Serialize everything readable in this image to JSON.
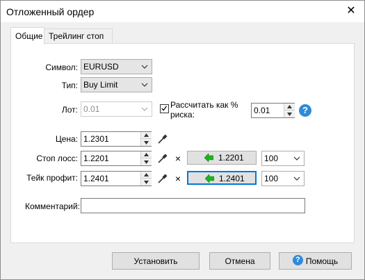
{
  "window": {
    "title": "Отложенный ордер",
    "close_glyph": "✕"
  },
  "tabs": [
    {
      "label": "Общие"
    },
    {
      "label": "Трейлинг стоп"
    }
  ],
  "form": {
    "symbol": {
      "label": "Символ:",
      "value": "EURUSD"
    },
    "type": {
      "label": "Тип:",
      "value": "Buy Limit"
    },
    "lot": {
      "label": "Лот:",
      "value": "0.01"
    },
    "risk": {
      "label_line1": "Рассчитать как %",
      "label_line2": "риска:",
      "checked": true,
      "value": "0.01"
    },
    "price": {
      "label": "Цена:",
      "value": "1.2301"
    },
    "stop_loss": {
      "label": "Стоп лосс:",
      "value": "1.2201",
      "button_value": "1.2201",
      "combo_value": "100"
    },
    "take_profit": {
      "label": "Тейк профит:",
      "value": "1.2401",
      "button_value": "1.2401",
      "combo_value": "100"
    },
    "comment": {
      "label": "Комментарий:",
      "value": ""
    }
  },
  "buttons": {
    "set": "Установить",
    "cancel": "Отмена",
    "help": "Помощь"
  },
  "colors": {
    "help_blue": "#2f8bd8",
    "arrow_green": "#1db51d",
    "focus_blue": "#0078d7"
  }
}
